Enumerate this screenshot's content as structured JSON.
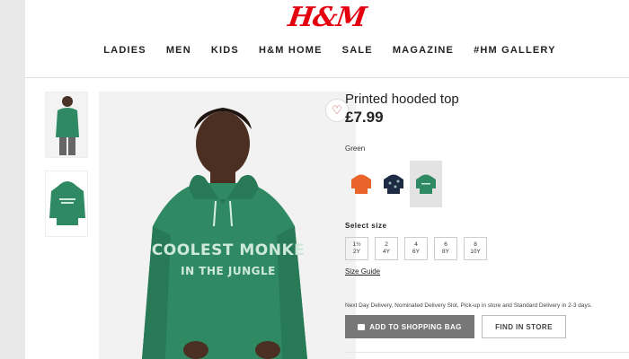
{
  "brand": {
    "logo_text": "H&M",
    "logo_color": "#e50010"
  },
  "nav": {
    "items": [
      "LADIES",
      "MEN",
      "KIDS",
      "H&M HOME",
      "SALE",
      "MAGAZINE",
      "#HM GALLERY"
    ]
  },
  "product": {
    "title": "Printed hooded top",
    "price": "£7.99",
    "color_label": "Green",
    "hoodie_print_line1": "COOLEST MONKE",
    "hoodie_print_line2": "IN THE JUNGLE",
    "swatches": [
      {
        "name": "orange",
        "color": "#e8642a"
      },
      {
        "name": "navy",
        "color": "#1f2a44"
      },
      {
        "name": "green",
        "color": "#2f8a63",
        "selected": true
      }
    ],
    "size_label": "Select size",
    "sizes": [
      {
        "top": "1½",
        "bottom": "2Y"
      },
      {
        "top": "2",
        "bottom": "4Y"
      },
      {
        "top": "4",
        "bottom": "6Y"
      },
      {
        "top": "6",
        "bottom": "8Y"
      },
      {
        "top": "8",
        "bottom": "10Y"
      }
    ],
    "size_guide": "Size Guide",
    "delivery_text": "Next Day Delivery, Nominated Delivery Slot, Pick-up in store and Standard Delivery in 2-3 days.",
    "add_to_bag": "ADD TO SHOPPING BAG",
    "find_in_store": "FIND IN STORE"
  },
  "icons": {
    "favorite": "heart-icon",
    "bag": "shopping-bag-icon"
  }
}
